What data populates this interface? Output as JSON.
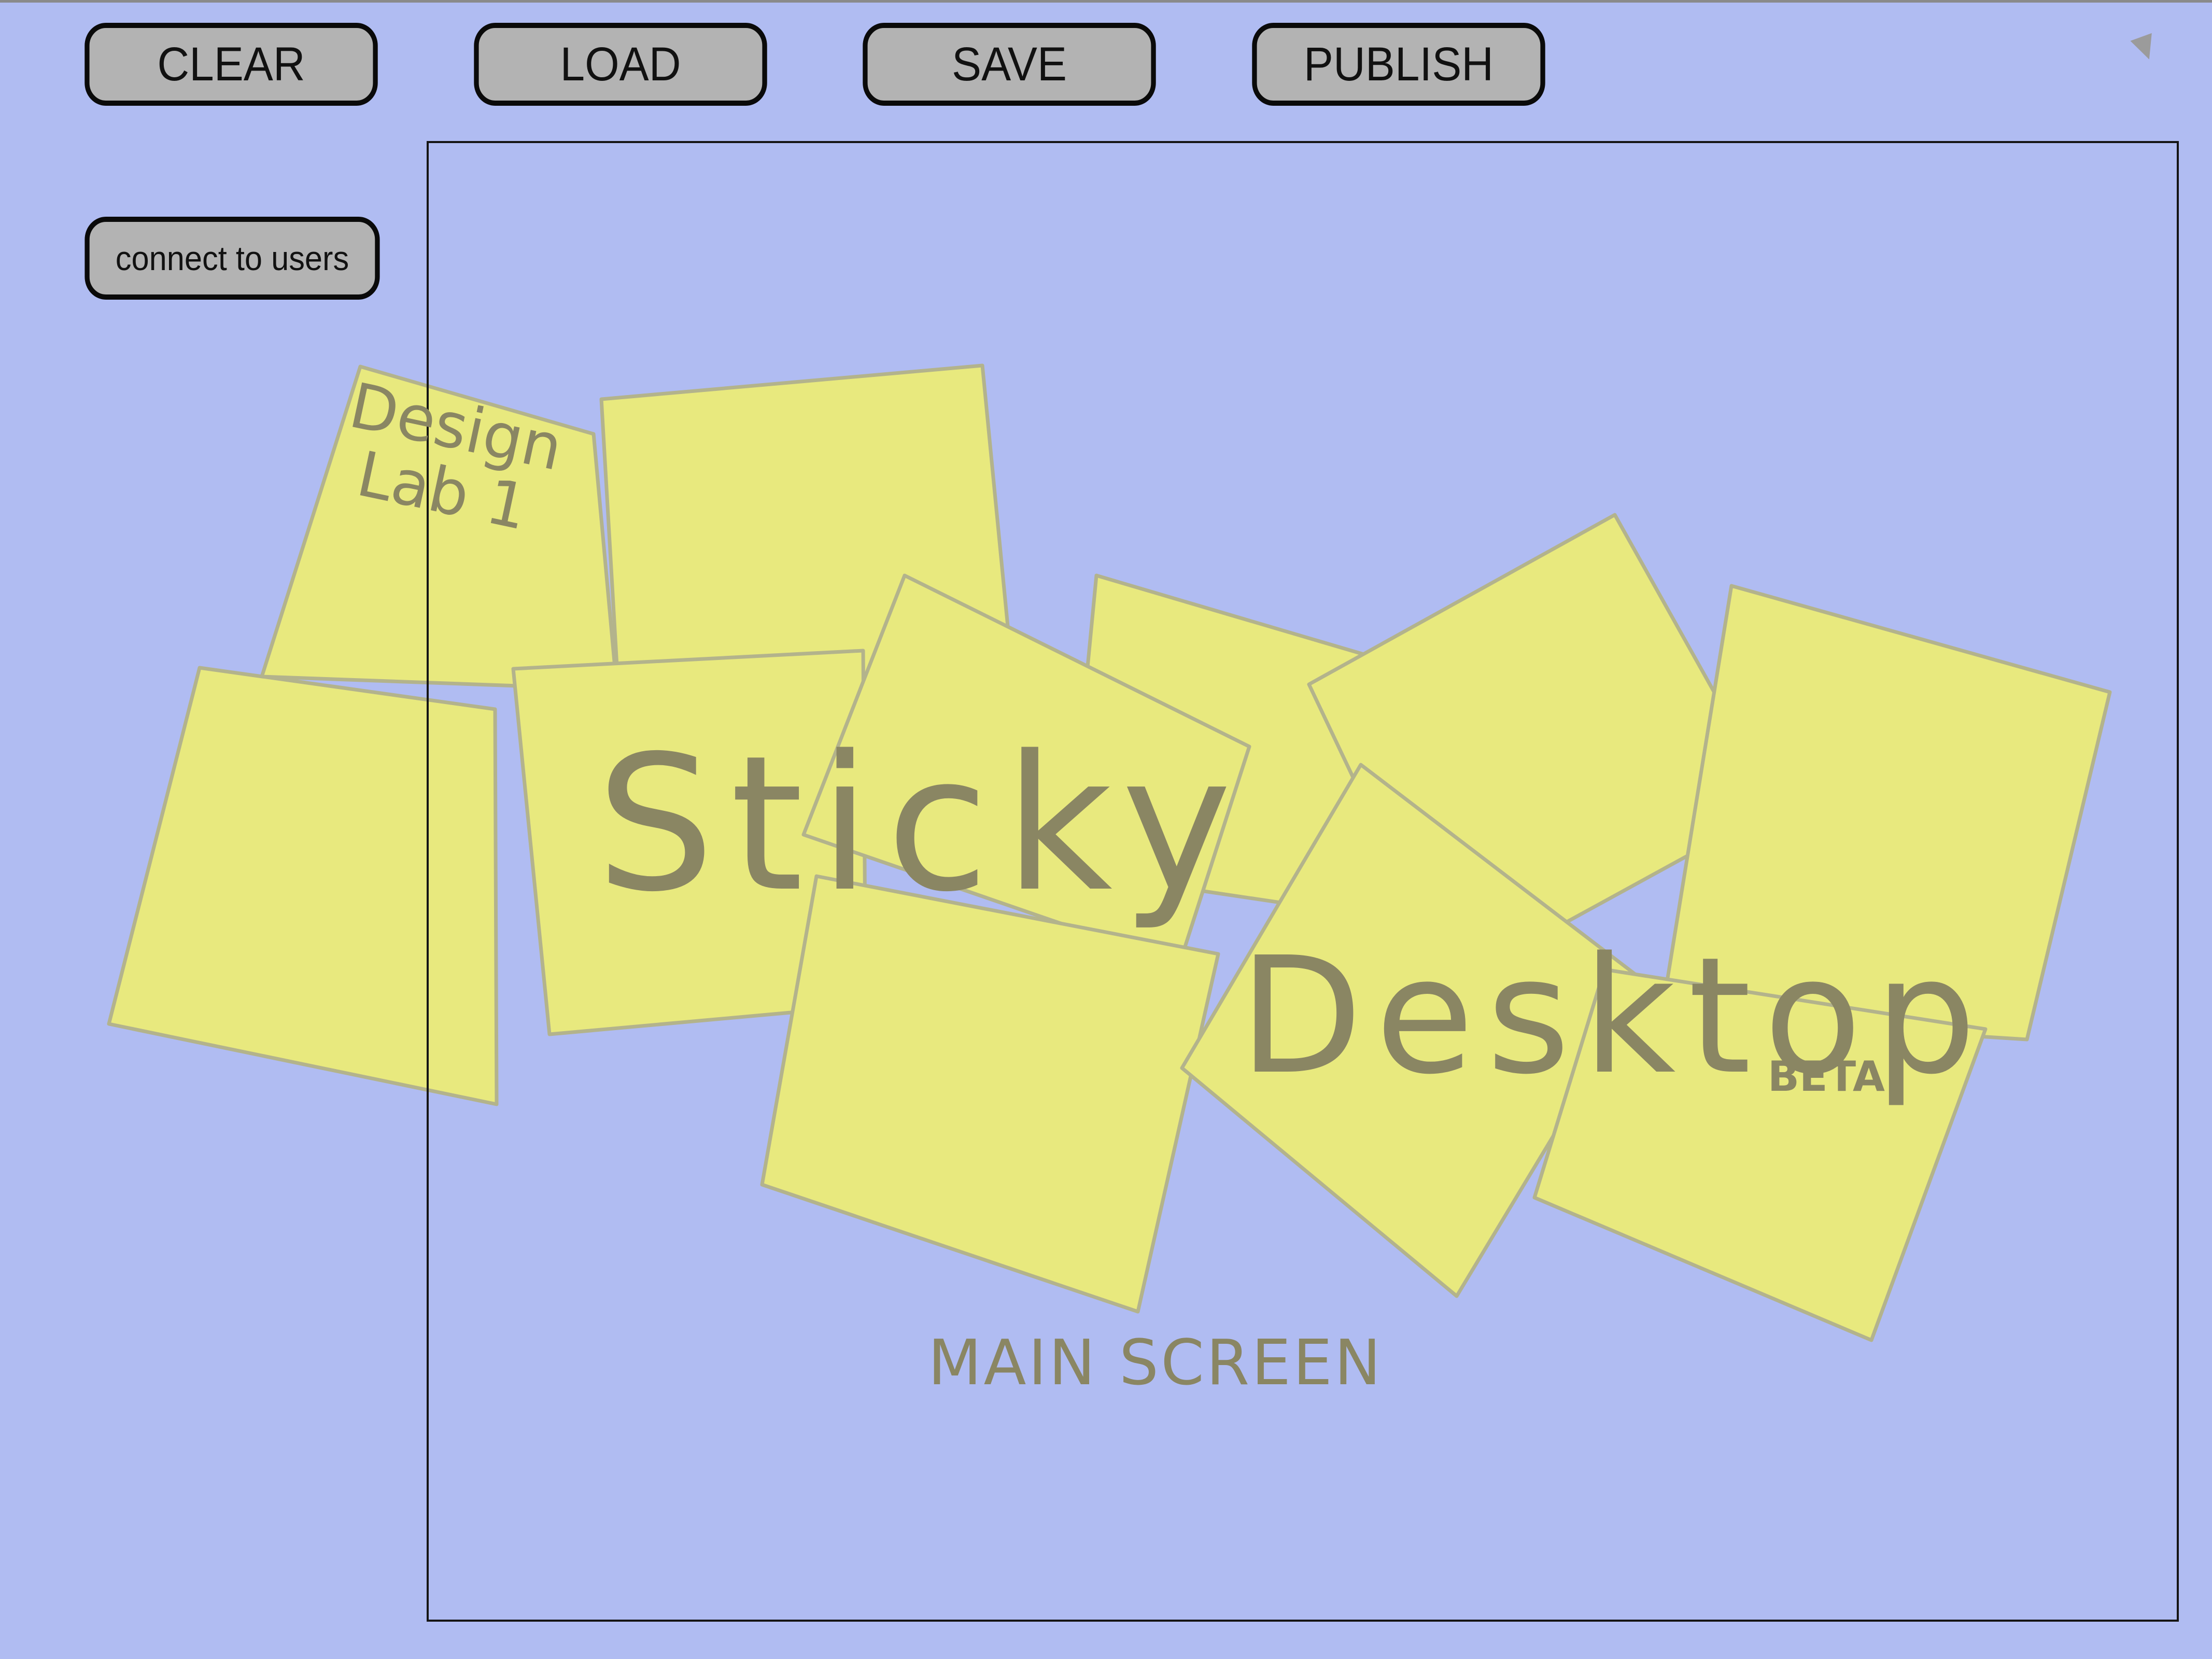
{
  "toolbar": {
    "clear_label": "CLEAR",
    "load_label": "LOAD",
    "save_label": "SAVE",
    "publish_label": "PUBLISH"
  },
  "side": {
    "connect_label": "connect to users"
  },
  "canvas": {
    "design_lab_label": "Design\nLab 1",
    "title_word_1": "Sticky",
    "title_word_2": "Desktop",
    "beta_label": "BETA",
    "caption": "MAIN SCREEN"
  },
  "colors": {
    "background": "#b0bcf2",
    "note_fill": "#e8e97e",
    "note_edge": "#b3b38c",
    "button_fill": "#b3b3b3",
    "button_border": "#0a0a0a",
    "handwriting": "#8a8663"
  }
}
